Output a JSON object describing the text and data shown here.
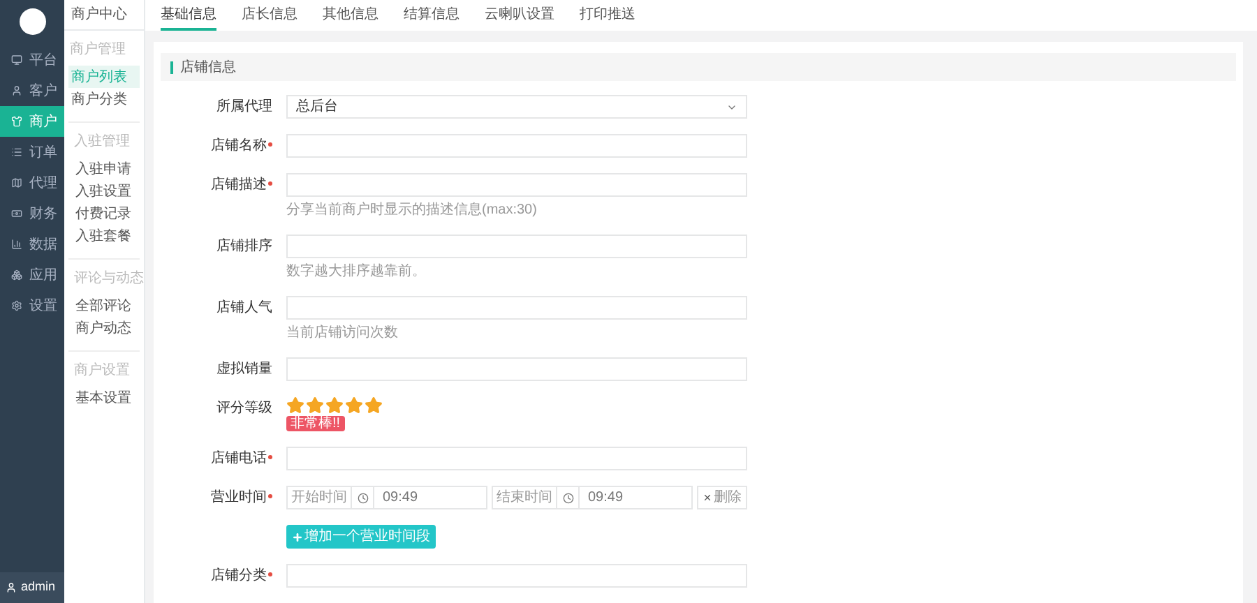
{
  "sidebar": {
    "items": [
      {
        "label": "平台",
        "selected": false
      },
      {
        "label": "客户",
        "selected": false
      },
      {
        "label": "商户",
        "selected": true
      },
      {
        "label": "订单",
        "selected": false
      },
      {
        "label": "代理",
        "selected": false
      },
      {
        "label": "财务",
        "selected": false
      },
      {
        "label": "数据",
        "selected": false
      },
      {
        "label": "应用",
        "selected": false
      },
      {
        "label": "设置",
        "selected": false
      }
    ],
    "user": "admin"
  },
  "subnav": {
    "title": "商户中心",
    "groups": [
      {
        "title": "商户管理",
        "items": [
          {
            "label": "商户列表",
            "selected": true
          },
          {
            "label": "商户分类",
            "selected": false
          }
        ]
      },
      {
        "title": "入驻管理",
        "items": [
          {
            "label": "入驻申请",
            "selected": false
          },
          {
            "label": "入驻设置",
            "selected": false
          },
          {
            "label": "付费记录",
            "selected": false
          },
          {
            "label": "入驻套餐",
            "selected": false
          }
        ]
      },
      {
        "title": "评论与动态",
        "items": [
          {
            "label": "全部评论",
            "selected": false
          },
          {
            "label": "商户动态",
            "selected": false
          }
        ]
      },
      {
        "title": "商户设置",
        "items": [
          {
            "label": "基本设置",
            "selected": false
          }
        ]
      }
    ]
  },
  "tabs": [
    {
      "label": "基础信息",
      "selected": true
    },
    {
      "label": "店长信息",
      "selected": false
    },
    {
      "label": "其他信息",
      "selected": false
    },
    {
      "label": "结算信息",
      "selected": false
    },
    {
      "label": "云喇叭设置",
      "selected": false
    },
    {
      "label": "打印推送",
      "selected": false
    }
  ],
  "section_title": "店铺信息",
  "fields": [
    {
      "kind": "select",
      "label": "所属代理",
      "value": "总后台",
      "required": false
    },
    {
      "kind": "input",
      "label": "店铺名称",
      "required": true
    },
    {
      "kind": "input",
      "label": "店铺描述",
      "required": true,
      "hint": "分享当前商户时显示的描述信息(max:30)"
    },
    {
      "kind": "input",
      "label": "店铺排序",
      "required": false,
      "hint": "数字越大排序越靠前。"
    },
    {
      "kind": "input",
      "label": "店铺人气",
      "required": false,
      "hint": "当前店铺访问次数"
    },
    {
      "kind": "input",
      "label": "虚拟销量",
      "required": false
    },
    {
      "kind": "stars",
      "label": "评分等级",
      "stars": 5,
      "badge": "非常棒!!"
    },
    {
      "kind": "input",
      "label": "店铺电话",
      "required": true
    },
    {
      "kind": "time_range",
      "label": "营业时间",
      "required": true,
      "start_label": "开始时间",
      "start_value": "09:49",
      "end_label": "结束时间",
      "end_value": "09:49",
      "delete_label": "删除"
    },
    {
      "kind": "button",
      "label": "增加一个营业时间段"
    },
    {
      "kind": "input",
      "label": "店铺分类",
      "required": true
    }
  ]
}
